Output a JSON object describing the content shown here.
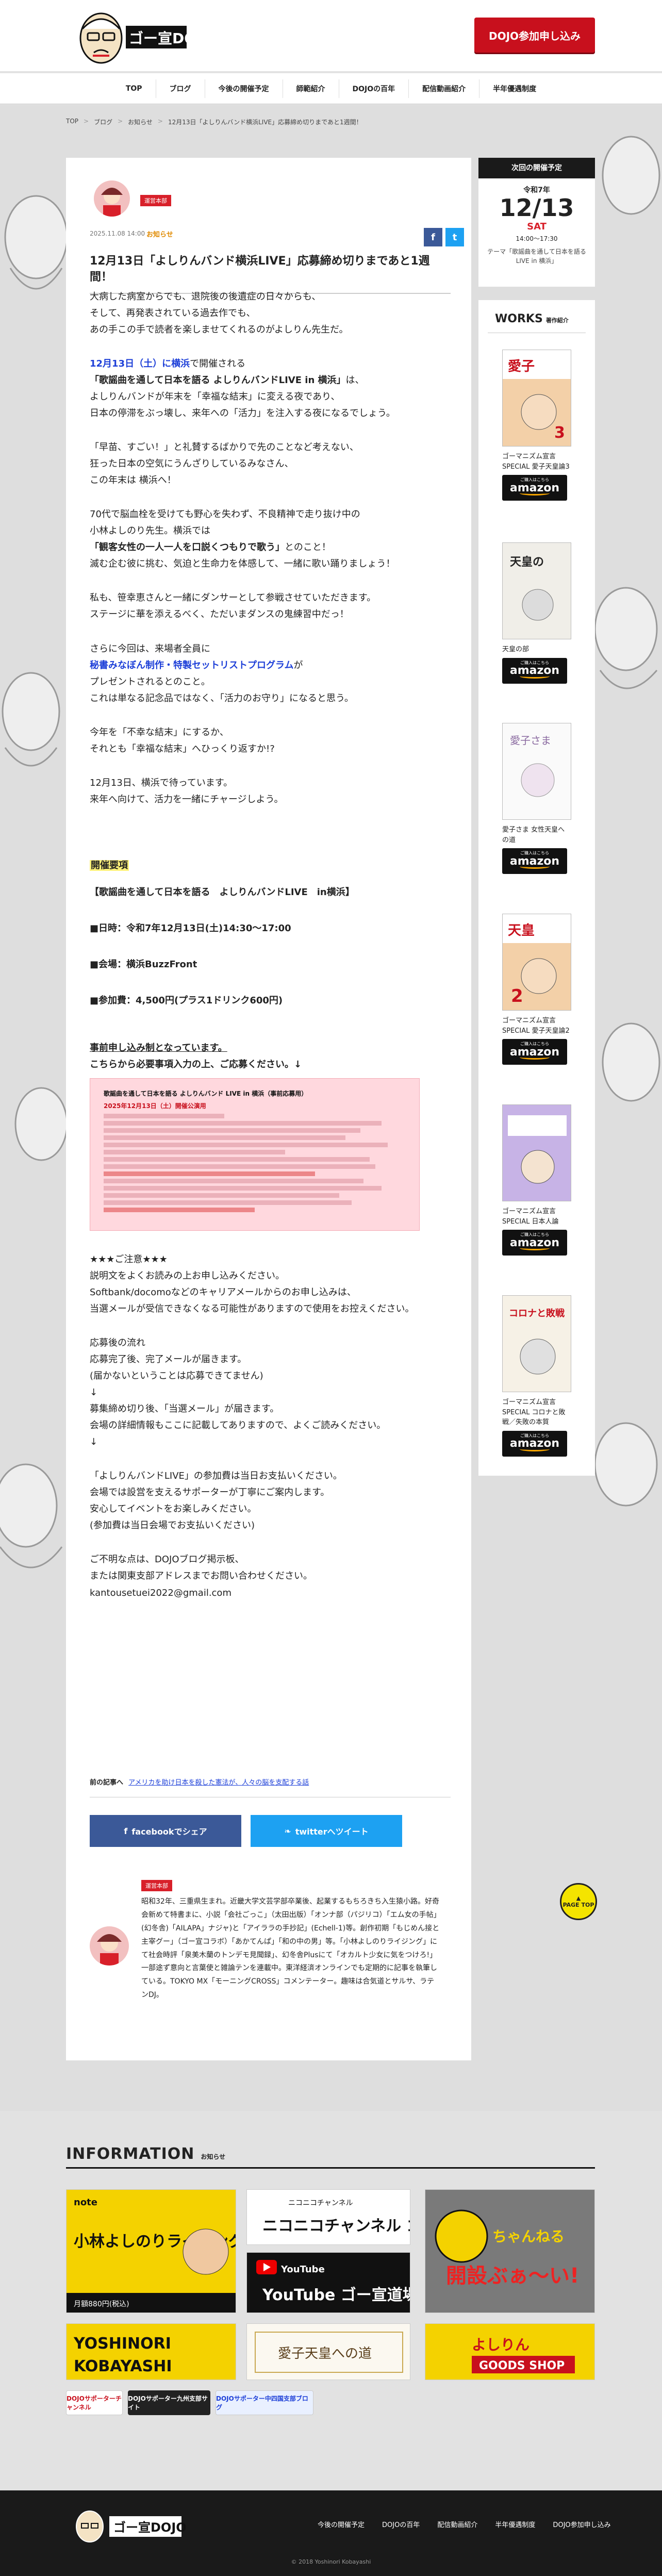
{
  "header": {
    "cta_label": "DOJO参加申し込み",
    "nav": [
      "TOP",
      "ブログ",
      "今後の開催予定",
      "師範紹介",
      "DOJOの百年",
      "配信動画紹介",
      "半年優遇制度"
    ]
  },
  "breadcrumb": [
    "TOP",
    "ブログ",
    "お知らせ",
    "12月13日「よしりんバンド横浜LIVE」応募締め切りまであと1週間！"
  ],
  "post": {
    "category_badge": "運営本部",
    "date": "2025.11.08 14:00",
    "category": "お知らせ",
    "share_fb_mini": "f",
    "share_tw_mini": "t",
    "title": "12月13日「よしりんバンド横浜LIVE」応募締め切りまであと1週間！",
    "p1": [
      "大病した病室からでも、退院後の後遺症の日々からも、",
      "そして、再発表されている過去作でも、",
      "あの手この手で読者を楽しませてくれるのがよしりん先生だ。"
    ],
    "p2_blue": "12月13日（土）に横浜",
    "p2_rest": "で開催される",
    "p2_bold": "「歌謡曲を通して日本を語る よしりんバンドLIVE in 横浜」",
    "p2_tail": "は、",
    "p2_lines": [
      "よしりんバンドが年末を「幸福な結末」に変える夜であり、",
      "日本の停滞をぶっ壊し、来年への「活力」を注入する夜になるでしょう。"
    ],
    "p3": [
      "「早苗、すごい！」と礼賛するばかりで先のことなど考えない、",
      "狂った日本の空気にうんざりしているみなさん、",
      "この年末は 横浜へ！"
    ],
    "p4_a": [
      "70代で脳血栓を受けても野心を失わず、不良精神で走り抜け中の",
      "小林よしのり先生。横浜では"
    ],
    "p4_bold": "「観客女性の一人一人を口説くつもりで歌う」",
    "p4_b": "とのこと！",
    "p4_c": "滅む企む彼に挑む、気迫と生命力を体感して、一緒に歌い踊りましょう！",
    "p5": [
      "私も、笹幸恵さんと一緒にダンサーとして参戦させていただきます。",
      "ステージに華を添えるべく、ただいまダンスの鬼練習中だっ！"
    ],
    "p6_a": "さらに今回は、来場者全員に",
    "p6_blue": "秘書みなぼん制作・特製セットリストプログラム",
    "p6_b": "が",
    "p6_c": [
      "プレゼントされるとのこと。",
      "これは単なる記念品ではなく、「活力のお守り」になると思う。"
    ],
    "p7": [
      "今年を「不幸な結末」にするか、",
      "それとも「幸福な結末」へひっくり返すか!?"
    ],
    "p8": [
      "12月13日、横浜で待っています。",
      "来年へ向けて、活力を一緒にチャージしよう。"
    ],
    "outline_label": "開催要項",
    "outline_title": "【歌謡曲を通して日本を語る　よしりんバンドLIVE　in横浜】",
    "outline_date": "■日時：令和7年12月13日(土)14:30〜17:00",
    "outline_venue": "■会場：横浜BuzzFront",
    "outline_fee": "■参加費：4,500円(プラス1ドリンク600円)",
    "reserve_a": "事前申し込み制となっています。",
    "reserve_b": "こちらから必要事項入力の上、ご応募ください。↓",
    "form": {
      "title": "歌謡曲を通して日本を語る よしりんバンド LIVE in 横浜（事前応募用）",
      "sub": "2025年12月13日（土）開催公演用"
    },
    "notes_head": "★★★ご注意★★★",
    "notes": [
      "説明文をよくお読みの上お申し込みください。",
      "Softbank/docomoなどのキャリアメールからのお申し込みは、",
      "当選メールが受信できなくなる可能性がありますので使用をお控えください。"
    ],
    "flow": [
      "応募後の流れ",
      "応募完了後、完了メールが届きます。",
      "(届かないということは応募できてません)",
      "↓",
      "募集締め切り後、「当選メール」が届きます。",
      "会場の詳細情報もここに記載してありますので、よくご読みください。",
      "↓"
    ],
    "pay": [
      "「よしりんバンドLIVE」の参加費は当日お支払いください。",
      "会場では設営を支えるサポーターが丁寧にご案内します。",
      "安心してイベントをお楽しみください。",
      "(参加費は当日会場でお支払いください)"
    ],
    "contact": [
      "ご不明な点は、DOJOブログ掲示板、",
      "または関東支部アドレスまでお問い合わせください。",
      "kantousetuei2022@gmail.com"
    ],
    "prev_label": "前の記事へ",
    "prev_link": "アメリカを助け日本を殺した憲法が、人々の脳を支配する話",
    "share_fb": "facebookでシェア",
    "share_tw": "twitterへツイート"
  },
  "author": {
    "badge": "運営本部",
    "desc": "昭和32年、三重県生まれ。近畿大学文芸学部卒業後、起業するもちろきち入生猿小路。好奇会新めて特書まに、小説「会社ごっこ」（太田出版）「オンナ部（パジリコ）「エム女の手帖」(幻冬舎)「AILAPA」ナジャ)と「アイララの手抄記」(Echell-1)等。創作初期「もじめん接と主宰グー」（ゴー宣コラボ）「あかてんぱ」「和の中の男」等。「小林よしのりライジング」にて社会時評「泉美木蘭のトンデモ見聞録」、幻冬舎Plusにて「オカルト少女に気をつけろ!」一部途ず意向と言葉使と雑論テンを連載中。東洋経済オンラインでも定期的に記事を執筆している。TOKYO MX「モーニングCROSS」コメンテーター。趣味は合気道とサルサ、ラテンDJ。"
  },
  "sidebar": {
    "event_head": "次回の開催予定",
    "event_year": "令和7年",
    "event_date": "12/13",
    "event_dow": "SAT",
    "event_time": "14:00〜17:30",
    "event_theme": "テーマ「歌謡曲を通して日本を語る LIVE in 横浜」",
    "works_head": "WORKS",
    "works_sub": "著作紹介",
    "amazon_small": "ご購入はこちら",
    "amazon": "amazon",
    "works": [
      "ゴーマニズム宣言SPECIAL 愛子天皇論3",
      "天皇の部",
      "愛子さま 女性天皇への道",
      "ゴーマニズム宣言SPECIAL 愛子天皇論2",
      "ゴーマニズム宣言SPECIAL 日本人論",
      "ゴーマニズム宣言SPECIAL コロナと敗戦／失敗の本質"
    ]
  },
  "info": {
    "head": "INFORMATION",
    "sub": "お知らせ",
    "banners": [
      "小林よしのりライジング",
      "ニコニコチャンネル ゴー宣道場",
      "YouTube ゴー宣道場",
      "あなたの公式ちゃんねる開設ぶぁ〜い！",
      "YOSHINORI KOBAYASHI",
      "愛子天皇への道",
      "よしりん GOODS SHOP",
      "DOJOサポーターチャンネル",
      "DOJOサポーター九州支部サイト",
      "DOJOサポーター中四国支部ブログ"
    ],
    "rising_price": "月額880円(税込)",
    "pagetop": "PAGE TOP"
  },
  "footer": {
    "nav": [
      "今後の開催予定",
      "DOJOの百年",
      "配信動画紹介",
      "半年優遇制度",
      "DOJO参加申し込み"
    ],
    "copy": "© 2018 Yoshinori Kobayashi"
  },
  "colors": {
    "accent": "#c8101d",
    "link": "#1d3fd8",
    "highlight": "#fff27a",
    "amazon": "#f7a600"
  }
}
